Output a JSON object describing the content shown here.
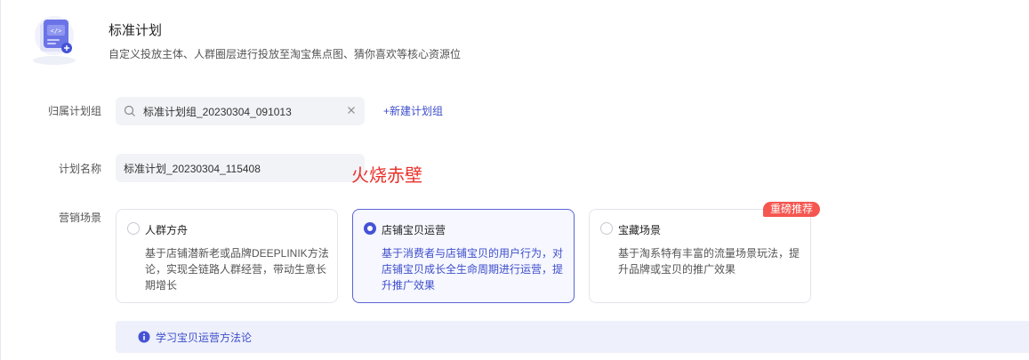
{
  "header": {
    "title": "标准计划",
    "description": "自定义投放主体、人群圈层进行投放至淘宝焦点图、猜你喜欢等核心资源位",
    "icon": "plan-card-icon"
  },
  "plan_group": {
    "label": "归属计划组",
    "value": "标准计划组_20230304_091013",
    "new_group_link": "+新建计划组"
  },
  "plan_name": {
    "label": "计划名称",
    "value": "标准计划_20230304_115408"
  },
  "annotation": "火烧赤壁",
  "scenarios": {
    "label": "营销场景",
    "selected": 1,
    "options": [
      {
        "title": "人群方舟",
        "description": "基于店铺潜新老或品牌DEEPLINIK方法论，实现全链路人群经营，带动生意长期增长"
      },
      {
        "title": "店铺宝贝运营",
        "description": "基于消费者与店铺宝贝的用户行为，对店铺宝贝成长全生命周期进行运营，提升推广效果"
      },
      {
        "title": "宝藏场景",
        "description": "基于淘系特有丰富的流量场景玩法，提升品牌或宝贝的推广效果",
        "badge": "重磅推荐"
      }
    ]
  },
  "info_bar": {
    "link": "学习宝贝运营方法论"
  },
  "colors": {
    "accent": "#4453d6",
    "badge": "#f5564f",
    "annotation": "#e8312a"
  }
}
